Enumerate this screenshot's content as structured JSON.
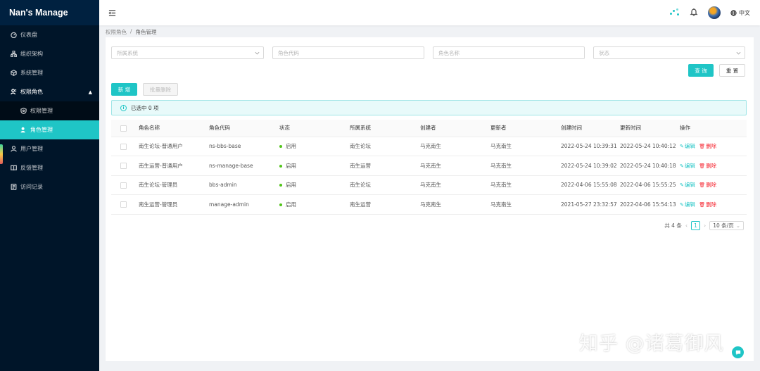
{
  "app": {
    "title": "Nan's Manage"
  },
  "sidebar": {
    "items": [
      {
        "label": "仪表盘",
        "icon": "dashboard-icon"
      },
      {
        "label": "组织架构",
        "icon": "org-icon"
      },
      {
        "label": "系统管理",
        "icon": "cube-icon"
      },
      {
        "label": "权限角色",
        "icon": "role-icon",
        "open": true,
        "children": [
          {
            "label": "权限管理",
            "icon": "shield-icon"
          },
          {
            "label": "角色管理",
            "icon": "user-icon",
            "active": true
          }
        ]
      },
      {
        "label": "用户管理",
        "icon": "user-icon"
      },
      {
        "label": "反馈管理",
        "icon": "book-icon"
      },
      {
        "label": "访问记录",
        "icon": "log-icon"
      }
    ]
  },
  "header": {
    "language": "中文"
  },
  "breadcrumb": [
    "权限角色",
    "角色管理"
  ],
  "filters": {
    "system_placeholder": "所属系统",
    "code_placeholder": "角色代码",
    "name_placeholder": "角色名称",
    "status_placeholder": "状态",
    "query_label": "查 询",
    "reset_label": "重 置"
  },
  "toolbar": {
    "add_label": "新 增",
    "batch_delete_label": "批量删除"
  },
  "selection": {
    "text": "已选中 0 项"
  },
  "table": {
    "columns": [
      "角色名称",
      "角色代码",
      "状态",
      "所属系统",
      "创建者",
      "更新者",
      "创建时间",
      "更新时间",
      "操作"
    ],
    "rows": [
      {
        "name": "南生论坛-普通用户",
        "code": "ns-bbs-base",
        "status": "启用",
        "system": "南生论坛",
        "creator": "马克南生",
        "updater": "马克南生",
        "created": "2022-05-24 10:39:31",
        "updated": "2022-05-24 10:40:12"
      },
      {
        "name": "南生运营-普通用户",
        "code": "ns-manage-base",
        "status": "启用",
        "system": "南生运营",
        "creator": "马克南生",
        "updater": "马克南生",
        "created": "2022-05-24 10:39:02",
        "updated": "2022-05-24 10:40:18"
      },
      {
        "name": "南生论坛-管理员",
        "code": "bbs-admin",
        "status": "启用",
        "system": "南生论坛",
        "creator": "马克南生",
        "updater": "马克南生",
        "created": "2022-04-06 15:55:08",
        "updated": "2022-04-06 15:55:25"
      },
      {
        "name": "南生运营-管理员",
        "code": "manage-admin",
        "status": "启用",
        "system": "南生运营",
        "creator": "马克南生",
        "updater": "马克南生",
        "created": "2021-05-27 23:32:57",
        "updated": "2022-04-06 15:54:13"
      }
    ],
    "edit_label": "编辑",
    "delete_label": "删除"
  },
  "pagination": {
    "total_text": "共 4 条",
    "current_page": "1",
    "page_size": "10 条/页"
  },
  "watermark": "知乎 @诸葛御风",
  "colors": {
    "accent": "#1fc5c6",
    "sidebar_bg": "#001529",
    "danger": "#f5222d",
    "success": "#52c41a"
  }
}
